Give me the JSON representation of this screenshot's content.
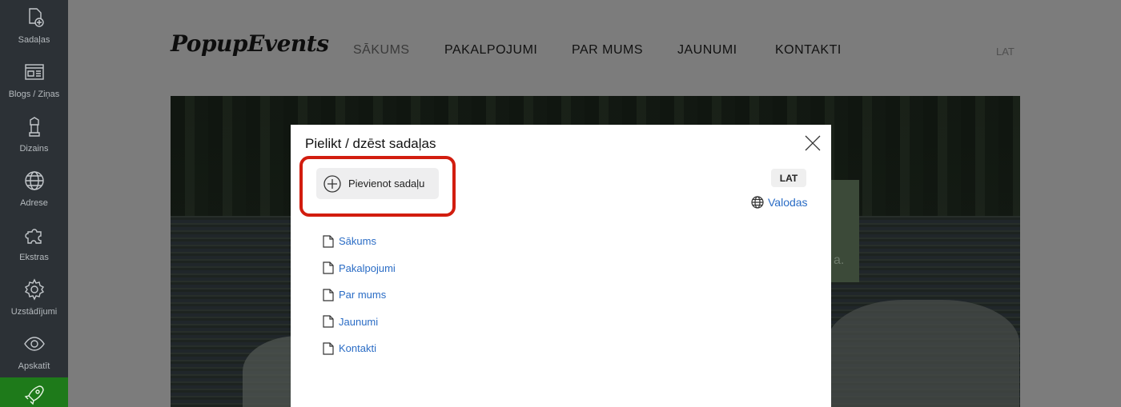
{
  "sidebar": {
    "items": [
      {
        "label": "Sadaļas",
        "icon": "add-page-icon"
      },
      {
        "label": "Blogs / Ziņas",
        "icon": "blog-icon"
      },
      {
        "label": "Dizains",
        "icon": "design-icon"
      },
      {
        "label": "Adrese",
        "icon": "globe-icon"
      },
      {
        "label": "Ekstras",
        "icon": "puzzle-icon"
      },
      {
        "label": "Uzstādījumi",
        "icon": "gear-icon"
      },
      {
        "label": "Apskatīt",
        "icon": "eye-icon"
      },
      {
        "label": "",
        "icon": "rocket-icon"
      }
    ]
  },
  "site": {
    "logo": "PopupEvents",
    "nav": [
      "SĀKUMS",
      "PAKALPOJUMI",
      "PAR MUMS",
      "JAUNUMI",
      "KONTAKTI"
    ],
    "language": "LAT",
    "hero_fragment": "a."
  },
  "modal": {
    "title": "Pielikt / dzēst sadaļas",
    "add_button": "Pievienot sadaļu",
    "lang_badge": "LAT",
    "languages_link": "Valodas",
    "pages": [
      "Sākums",
      "Pakalpojumi",
      "Par mums",
      "Jaunumi",
      "Kontakti"
    ],
    "highlight_color": "#d21d0f",
    "link_color": "#2a6cc5"
  }
}
